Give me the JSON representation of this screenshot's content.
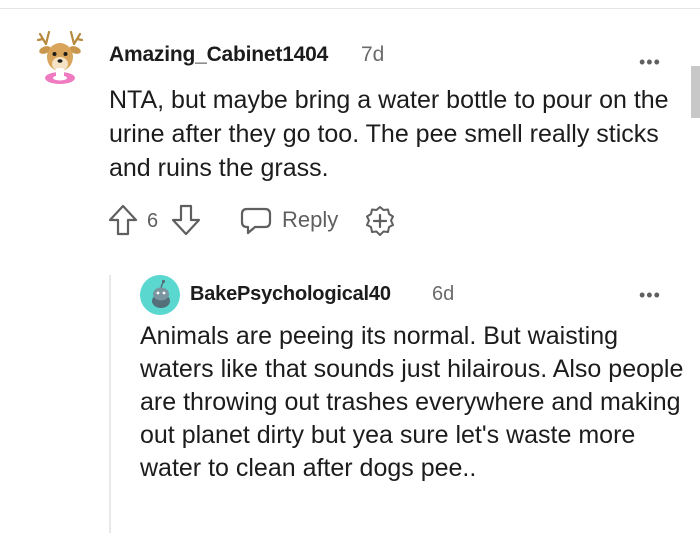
{
  "comment": {
    "username": "Amazing_Cabinet1404",
    "age": "7d",
    "more": "•••",
    "text": "NTA, but maybe bring a water bottle to pour on the urine after they go too. The pee smell really sticks and ruins the grass.",
    "score": "6",
    "reply_label": "Reply",
    "icons": [
      "avatar-deer",
      "upvote-icon",
      "downvote-icon",
      "reply-icon",
      "award-icon",
      "more-options-icon"
    ]
  },
  "reply": {
    "username": "BakePsychological40",
    "age": "6d",
    "more": "•••",
    "text": "Animals are peeing its normal. But waisting waters like that sounds just hilairous. Also people are throwing out trashes everywhere and making out planet dirty but yea sure let's waste more water to clean after dogs pee..",
    "icons": [
      "avatar-snoo",
      "more-options-icon"
    ]
  },
  "colors": {
    "text": "#1c1c1c",
    "meta": "#6b6b6b",
    "icon": "#5f5f5f",
    "avatar_teal": "#5ad8d0",
    "thread_line": "#e8e8e8"
  }
}
